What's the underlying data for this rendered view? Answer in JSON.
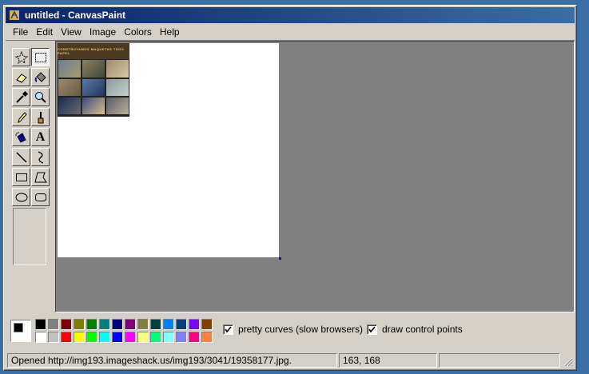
{
  "window": {
    "title": "untitled - CanvasPaint"
  },
  "menu": [
    "File",
    "Edit",
    "View",
    "Image",
    "Colors",
    "Help"
  ],
  "tools": [
    {
      "name": "free-select",
      "icon": "free-select-icon",
      "selected": false
    },
    {
      "name": "rect-select",
      "icon": "rect-select-icon",
      "selected": true
    },
    {
      "name": "eraser",
      "icon": "eraser-icon",
      "selected": false
    },
    {
      "name": "fill",
      "icon": "fill-bucket-icon",
      "selected": false
    },
    {
      "name": "color-picker",
      "icon": "eyedropper-icon",
      "selected": false
    },
    {
      "name": "magnifier",
      "icon": "magnifier-icon",
      "selected": false
    },
    {
      "name": "pencil",
      "icon": "pencil-icon",
      "selected": false
    },
    {
      "name": "brush",
      "icon": "brush-icon",
      "selected": false
    },
    {
      "name": "airbrush",
      "icon": "airbrush-icon",
      "selected": false
    },
    {
      "name": "text",
      "icon": "text-icon",
      "selected": false
    },
    {
      "name": "line",
      "icon": "line-icon",
      "selected": false
    },
    {
      "name": "curve",
      "icon": "curve-icon",
      "selected": false
    },
    {
      "name": "rectangle",
      "icon": "rectangle-icon",
      "selected": false
    },
    {
      "name": "polygon",
      "icon": "polygon-icon",
      "selected": false
    },
    {
      "name": "ellipse",
      "icon": "ellipse-icon",
      "selected": false
    },
    {
      "name": "rounded-rectangle",
      "icon": "rounded-rect-icon",
      "selected": false
    }
  ],
  "text_tool_glyph": "A",
  "image_banner": "CONSTRUYAMOS MAQUETAS TODO PAPEL",
  "colors": {
    "foreground": "#000000",
    "background": "#ffffff",
    "palette_top": [
      "#000000",
      "#808080",
      "#800000",
      "#808000",
      "#008000",
      "#008080",
      "#000080",
      "#800080",
      "#808040",
      "#004040",
      "#0080ff",
      "#004080",
      "#8000ff",
      "#804000"
    ],
    "palette_bottom": [
      "#ffffff",
      "#c0c0c0",
      "#ff0000",
      "#ffff00",
      "#00ff00",
      "#00ffff",
      "#0000ff",
      "#ff00ff",
      "#ffff80",
      "#00ff80",
      "#80ffff",
      "#8080ff",
      "#ff0080",
      "#ff8040"
    ]
  },
  "options": {
    "pretty_curves": {
      "label": "pretty curves (slow browsers)",
      "checked": true
    },
    "control_points": {
      "label": "draw control points",
      "checked": true
    }
  },
  "status": {
    "message": "Opened http://img193.imageshack.us/img193/3041/19358177.jpg.",
    "coords": "163, 168",
    "extra": ""
  }
}
